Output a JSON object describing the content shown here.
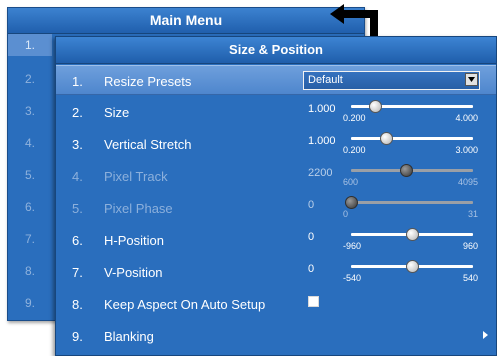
{
  "main_menu": {
    "title": "Main Menu",
    "numbers": [
      "1.",
      "2.",
      "3.",
      "4.",
      "5.",
      "6.",
      "7.",
      "8.",
      "9."
    ]
  },
  "size_position": {
    "title": "Size & Position",
    "rows": [
      {
        "num": "1.",
        "label": "Resize Presets",
        "control": "dropdown",
        "value": "Default",
        "selected": true,
        "enabled": true
      },
      {
        "num": "2.",
        "label": "Size",
        "control": "slider",
        "value": "1.000",
        "min": "0.200",
        "max": "4.000",
        "position": 0.2,
        "enabled": true
      },
      {
        "num": "3.",
        "label": "Vertical Stretch",
        "control": "slider",
        "value": "1.000",
        "min": "0.200",
        "max": "3.000",
        "position": 0.29,
        "enabled": true
      },
      {
        "num": "4.",
        "label": "Pixel Track",
        "control": "slider",
        "value": "2200",
        "min": "600",
        "max": "4095",
        "position": 0.45,
        "enabled": false
      },
      {
        "num": "5.",
        "label": "Pixel Phase",
        "control": "slider",
        "value": "0",
        "min": "0",
        "max": "31",
        "position": 0.0,
        "enabled": false
      },
      {
        "num": "6.",
        "label": "H-Position",
        "control": "slider",
        "value": "0",
        "min": "-960",
        "max": "960",
        "position": 0.5,
        "enabled": true
      },
      {
        "num": "7.",
        "label": "V-Position",
        "control": "slider",
        "value": "0",
        "min": "-540",
        "max": "540",
        "position": 0.5,
        "enabled": true
      },
      {
        "num": "8.",
        "label": "Keep Aspect On Auto Setup",
        "control": "checkbox",
        "checked": false,
        "enabled": true
      },
      {
        "num": "9.",
        "label": "Blanking",
        "control": "submenu",
        "enabled": true
      }
    ]
  },
  "colors": {
    "panel_blue": "#2a6ebd",
    "selected_row": "#5b8fd1",
    "disabled_text": "#8cb0dc"
  },
  "icons": {
    "pointer": "elbow-arrow-icon",
    "dropdown": "chevron-down-icon",
    "submenu": "triangle-right-icon"
  }
}
